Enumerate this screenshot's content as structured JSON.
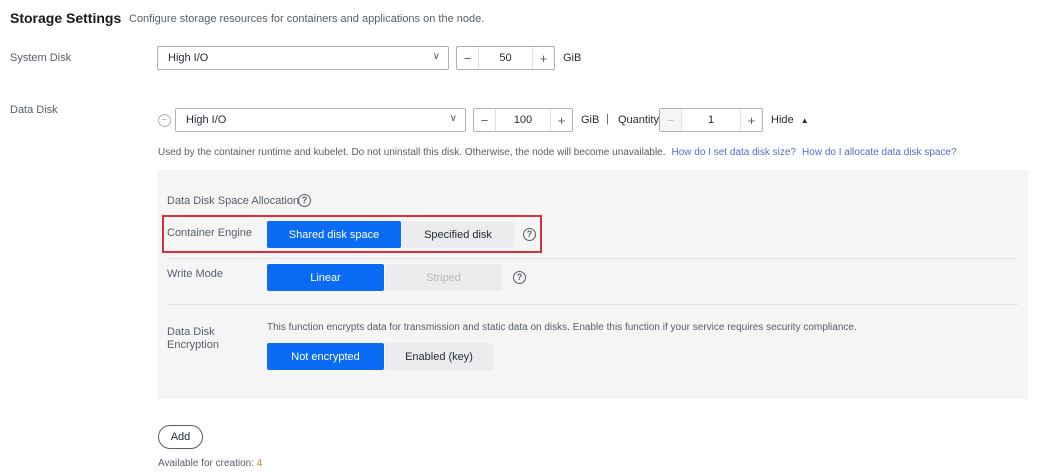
{
  "section": {
    "title": "Storage Settings",
    "description": "Configure storage resources for containers and applications on the node."
  },
  "system_disk": {
    "label": "System Disk",
    "type": "High I/O",
    "size": "50",
    "unit": "GiB"
  },
  "data_disk": {
    "label": "Data Disk",
    "type": "High I/O",
    "size": "100",
    "unit": "GiB",
    "separator": "|",
    "quantity_label": "Quantity",
    "quantity": "1",
    "hide_label": "Hide",
    "hint": "Used by the container runtime and kubelet. Do not uninstall this disk. Otherwise, the node will become unavailable.",
    "link_size": "How do I set data disk size?",
    "link_allocate": "How do I allocate data disk space?"
  },
  "allocation": {
    "title": "Data Disk Space Allocation",
    "container_engine": {
      "label": "Container Engine",
      "options": [
        "Shared disk space",
        "Specified disk"
      ],
      "selected": "Shared disk space"
    },
    "write_mode": {
      "label": "Write Mode",
      "options": [
        "Linear",
        "Striped"
      ],
      "selected": "Linear"
    },
    "encryption": {
      "label_line1": "Data Disk",
      "label_line2": "Encryption",
      "description": "This function encrypts data for transmission and static data on disks. Enable this function if your service requires security compliance.",
      "options": [
        "Not encrypted",
        "Enabled (key)"
      ],
      "selected": "Not encrypted"
    }
  },
  "add_button": "Add",
  "available": {
    "label": "Available for creation:",
    "count": "4"
  },
  "icons": {
    "dropdown": "chevron-down-icon",
    "help": "question-circle-icon",
    "remove": "minus-circle-icon",
    "collapse": "caret-up-icon"
  },
  "colors": {
    "primary": "#0a6cf5",
    "link": "#526ecc",
    "highlight": "#d9303b",
    "count": "#e37b1f"
  }
}
